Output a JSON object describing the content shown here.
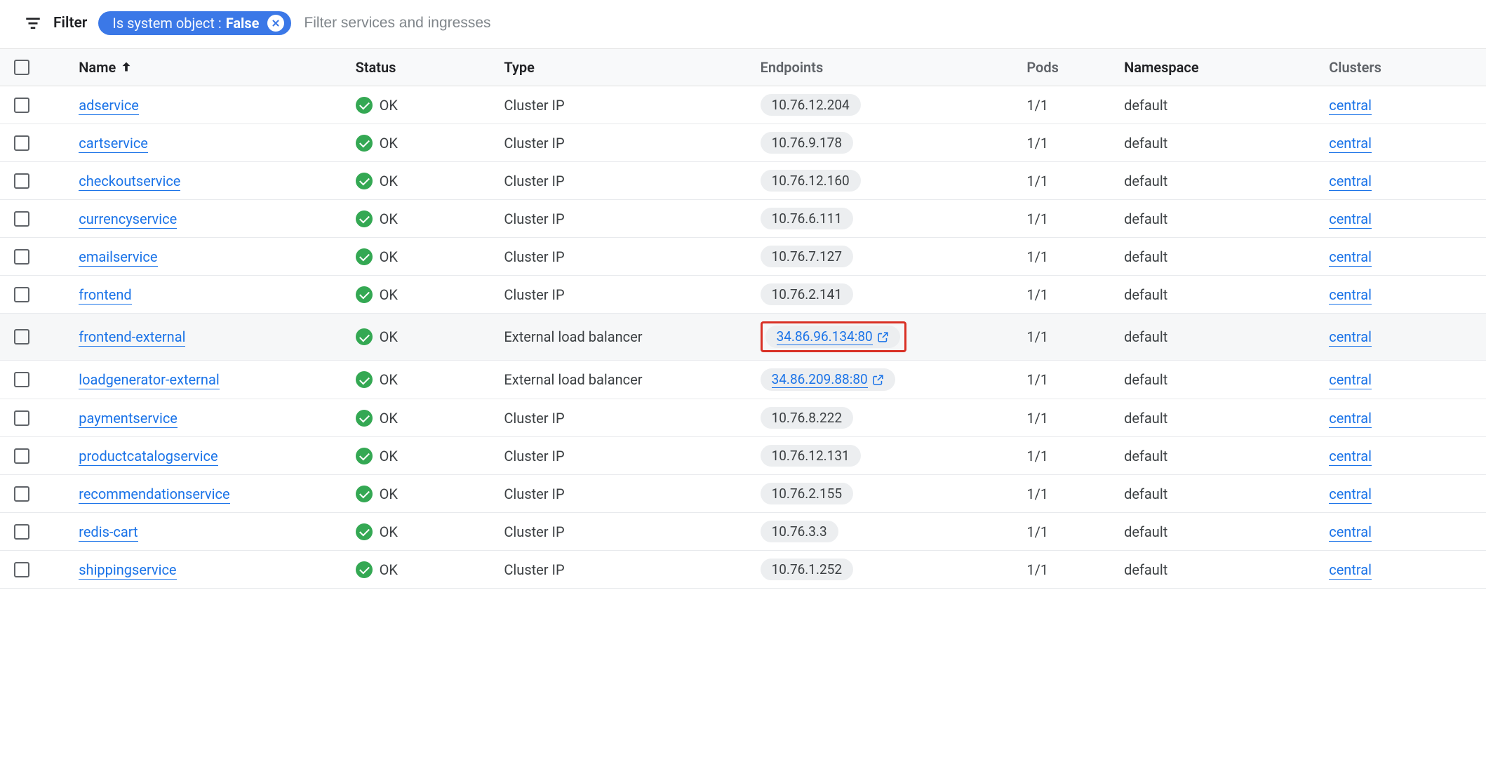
{
  "filter": {
    "label": "Filter",
    "chip_prefix": "Is system object : ",
    "chip_value": "False",
    "placeholder": "Filter services and ingresses"
  },
  "columns": {
    "name": "Name",
    "status": "Status",
    "type": "Type",
    "endpoints": "Endpoints",
    "pods": "Pods",
    "namespace": "Namespace",
    "clusters": "Clusters"
  },
  "status_ok_label": "OK",
  "rows": [
    {
      "name": "adservice",
      "status": "OK",
      "type": "Cluster IP",
      "endpoint": "10.76.12.204",
      "endpoint_link": false,
      "pods": "1/1",
      "namespace": "default",
      "cluster": "central",
      "highlighted": false,
      "red_box": false
    },
    {
      "name": "cartservice",
      "status": "OK",
      "type": "Cluster IP",
      "endpoint": "10.76.9.178",
      "endpoint_link": false,
      "pods": "1/1",
      "namespace": "default",
      "cluster": "central",
      "highlighted": false,
      "red_box": false
    },
    {
      "name": "checkoutservice",
      "status": "OK",
      "type": "Cluster IP",
      "endpoint": "10.76.12.160",
      "endpoint_link": false,
      "pods": "1/1",
      "namespace": "default",
      "cluster": "central",
      "highlighted": false,
      "red_box": false
    },
    {
      "name": "currencyservice",
      "status": "OK",
      "type": "Cluster IP",
      "endpoint": "10.76.6.111",
      "endpoint_link": false,
      "pods": "1/1",
      "namespace": "default",
      "cluster": "central",
      "highlighted": false,
      "red_box": false
    },
    {
      "name": "emailservice",
      "status": "OK",
      "type": "Cluster IP",
      "endpoint": "10.76.7.127",
      "endpoint_link": false,
      "pods": "1/1",
      "namespace": "default",
      "cluster": "central",
      "highlighted": false,
      "red_box": false
    },
    {
      "name": "frontend",
      "status": "OK",
      "type": "Cluster IP",
      "endpoint": "10.76.2.141",
      "endpoint_link": false,
      "pods": "1/1",
      "namespace": "default",
      "cluster": "central",
      "highlighted": false,
      "red_box": false
    },
    {
      "name": "frontend-external",
      "status": "OK",
      "type": "External load balancer",
      "endpoint": "34.86.96.134:80",
      "endpoint_link": true,
      "pods": "1/1",
      "namespace": "default",
      "cluster": "central",
      "highlighted": true,
      "red_box": true
    },
    {
      "name": "loadgenerator-external",
      "status": "OK",
      "type": "External load balancer",
      "endpoint": "34.86.209.88:80",
      "endpoint_link": true,
      "pods": "1/1",
      "namespace": "default",
      "cluster": "central",
      "highlighted": false,
      "red_box": false
    },
    {
      "name": "paymentservice",
      "status": "OK",
      "type": "Cluster IP",
      "endpoint": "10.76.8.222",
      "endpoint_link": false,
      "pods": "1/1",
      "namespace": "default",
      "cluster": "central",
      "highlighted": false,
      "red_box": false
    },
    {
      "name": "productcatalogservice",
      "status": "OK",
      "type": "Cluster IP",
      "endpoint": "10.76.12.131",
      "endpoint_link": false,
      "pods": "1/1",
      "namespace": "default",
      "cluster": "central",
      "highlighted": false,
      "red_box": false
    },
    {
      "name": "recommendationservice",
      "status": "OK",
      "type": "Cluster IP",
      "endpoint": "10.76.2.155",
      "endpoint_link": false,
      "pods": "1/1",
      "namespace": "default",
      "cluster": "central",
      "highlighted": false,
      "red_box": false
    },
    {
      "name": "redis-cart",
      "status": "OK",
      "type": "Cluster IP",
      "endpoint": "10.76.3.3",
      "endpoint_link": false,
      "pods": "1/1",
      "namespace": "default",
      "cluster": "central",
      "highlighted": false,
      "red_box": false
    },
    {
      "name": "shippingservice",
      "status": "OK",
      "type": "Cluster IP",
      "endpoint": "10.76.1.252",
      "endpoint_link": false,
      "pods": "1/1",
      "namespace": "default",
      "cluster": "central",
      "highlighted": false,
      "red_box": false
    }
  ]
}
